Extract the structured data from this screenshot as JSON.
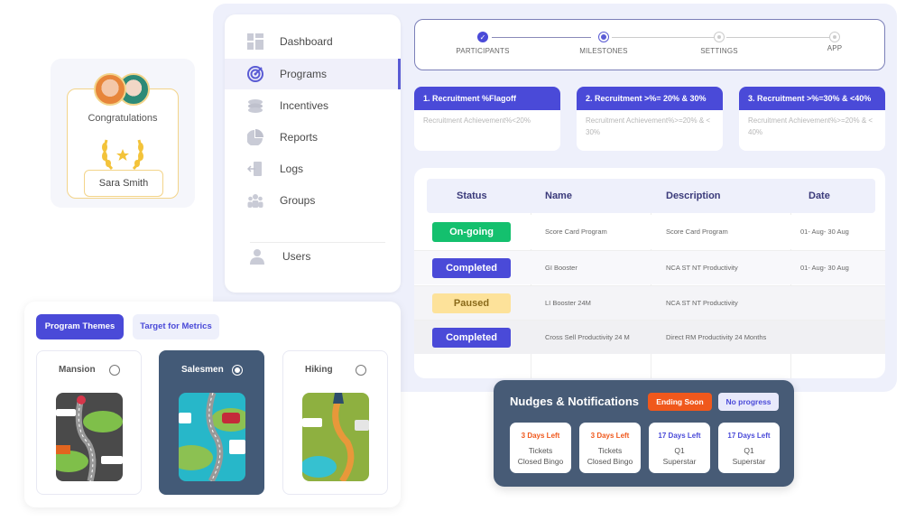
{
  "sidebar": {
    "items": [
      {
        "label": "Dashboard",
        "icon": "dashboard-icon",
        "active": false
      },
      {
        "label": "Programs",
        "icon": "target-icon",
        "active": true
      },
      {
        "label": "Incentives",
        "icon": "coins-icon",
        "active": false
      },
      {
        "label": "Reports",
        "icon": "pie-chart-icon",
        "active": false
      },
      {
        "label": "Logs",
        "icon": "logout-door-icon",
        "active": false
      },
      {
        "label": "Groups",
        "icon": "group-icon",
        "active": false
      }
    ],
    "users": {
      "label": "Users",
      "icon": "user-icon"
    }
  },
  "stepper": {
    "steps": [
      {
        "label": "PARTICIPANTS",
        "state": "done"
      },
      {
        "label": "MILESTONES",
        "state": "current"
      },
      {
        "label": "SETTINGS",
        "state": "pending"
      },
      {
        "label": "APP",
        "state": "pending"
      }
    ]
  },
  "milestones": [
    {
      "title": "1. Recruitment %Flagoff",
      "desc": "Recruitment Achievement%<20%"
    },
    {
      "title": "2. Recruitment >%= 20% & 30%",
      "desc": "Recruitment Achievement%>=20% & < 30%"
    },
    {
      "title": "3. Recruitment >%=30% & <40%",
      "desc": "Recruitment Achievement%>=20% & < 40%"
    }
  ],
  "programs_table": {
    "headers": [
      "Status",
      "Name",
      "Description",
      "Date"
    ],
    "rows": [
      {
        "status": "On-going",
        "name": "Score Card Program",
        "description": "Score Card Program",
        "date": "01- Aug- 30 Aug"
      },
      {
        "status": "Completed",
        "name": "GI Booster",
        "description": "NCA ST NT Productivity",
        "date": "01- Aug- 30 Aug"
      },
      {
        "status": "Paused",
        "name": "LI Booster 24M",
        "description": "NCA ST NT Productivity",
        "date": ""
      },
      {
        "status": "Completed",
        "name": "Cross Sell Productivity 24 M",
        "description": "Direct RM Productivity 24 Months",
        "date": ""
      }
    ]
  },
  "status_colors": {
    "On-going": "#14c06e",
    "Completed": "#4a4ad8",
    "Paused": "#fde29a"
  },
  "congrats": {
    "title": "Congratulations",
    "name": "Sara Smith"
  },
  "themes": {
    "tabs": [
      "Program Themes",
      "Target for Metrics"
    ],
    "active_tab": "Program Themes",
    "cards": [
      {
        "name": "Mansion",
        "selected": false
      },
      {
        "name": "Salesmen",
        "selected": true
      },
      {
        "name": "Hiking",
        "selected": false
      }
    ]
  },
  "nudges": {
    "title": "Nudges & Notifications",
    "filters": [
      "Ending Soon",
      "No progress"
    ],
    "cards": [
      {
        "days": "3 Days Left",
        "line1": "Tickets",
        "line2": "Closed Bingo",
        "urgent": true
      },
      {
        "days": "3 Days Left",
        "line1": "Tickets",
        "line2": "Closed Bingo",
        "urgent": true
      },
      {
        "days": "17 Days Left",
        "line1": "Q1",
        "line2": "Superstar",
        "urgent": false
      },
      {
        "days": "17 Days Left",
        "line1": "Q1",
        "line2": "Superstar",
        "urgent": false
      }
    ]
  },
  "colors": {
    "accent": "#4a4ad8",
    "urgent": "#f0581c",
    "dark_panel": "#475b76",
    "gold": "#f3c33a"
  }
}
